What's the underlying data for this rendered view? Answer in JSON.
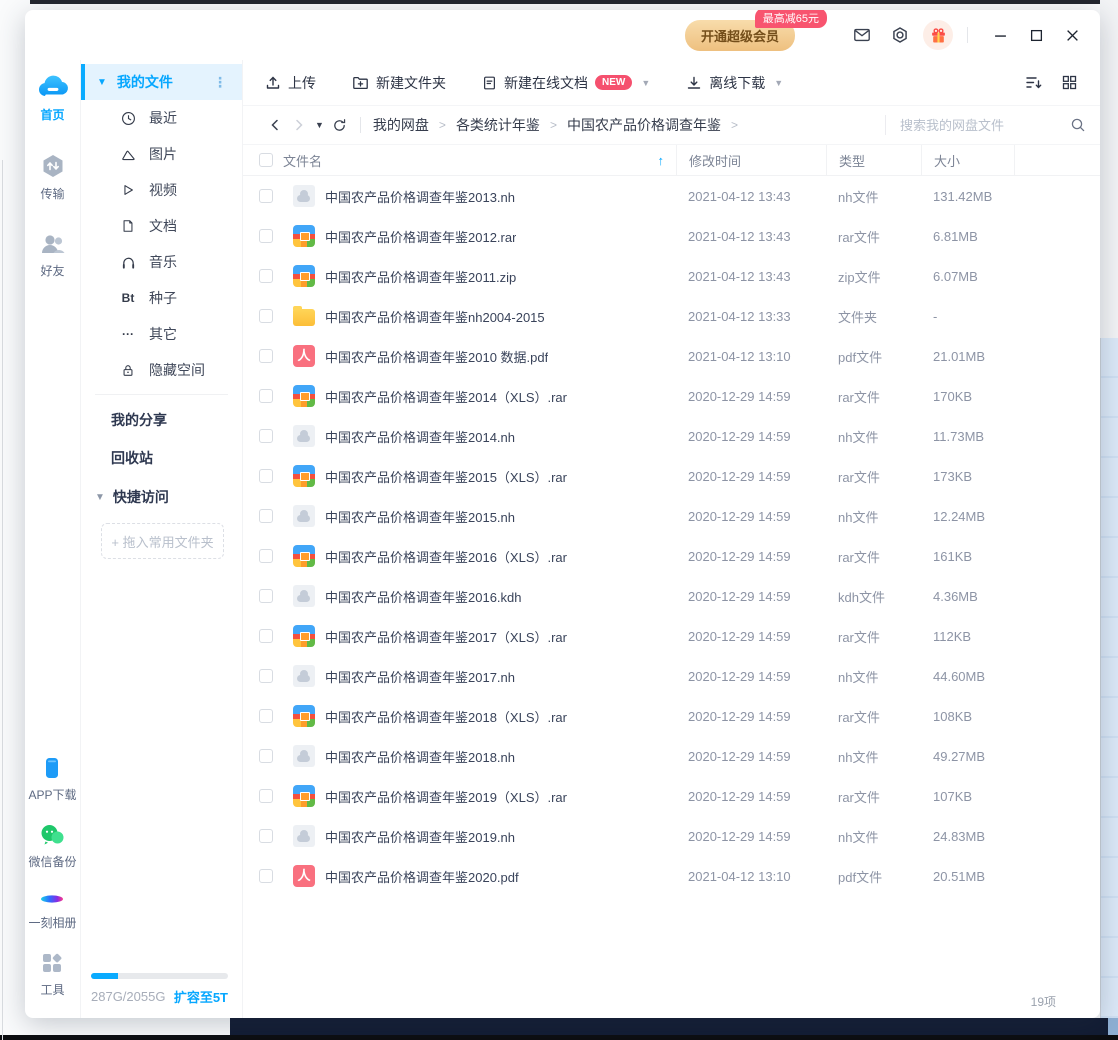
{
  "titlebar": {
    "vip_button": "开通超级会员",
    "vip_badge": "最高减65元"
  },
  "rail": {
    "items": [
      {
        "label": "首页",
        "icon": "cloud-logo"
      },
      {
        "label": "传输",
        "icon": "transfer"
      },
      {
        "label": "好友",
        "icon": "friends"
      }
    ],
    "bottom_items": [
      {
        "label": "APP下载",
        "icon": "phone"
      },
      {
        "label": "微信备份",
        "icon": "wechat"
      },
      {
        "label": "一刻相册",
        "icon": "album"
      },
      {
        "label": "工具",
        "icon": "tools"
      }
    ]
  },
  "sidebar": {
    "my_files": "我的文件",
    "items": [
      {
        "label": "最近",
        "icon": "clock-icon"
      },
      {
        "label": "图片",
        "icon": "image-icon"
      },
      {
        "label": "视频",
        "icon": "video-icon"
      },
      {
        "label": "文档",
        "icon": "doc-icon"
      },
      {
        "label": "音乐",
        "icon": "music-icon"
      },
      {
        "label": "种子",
        "icon": "bt-icon",
        "glyph": "Bt"
      },
      {
        "label": "其它",
        "icon": "more-icon",
        "glyph": "···"
      },
      {
        "label": "隐藏空间",
        "icon": "lock-icon"
      }
    ],
    "my_share": "我的分享",
    "recycle_bin": "回收站",
    "quick_access": "快捷访问",
    "drop_hint": "+ 拖入常用文件夹",
    "storage": {
      "used": "287G/2055G",
      "expand": "扩容至5T",
      "percent": 20
    }
  },
  "toolbar": {
    "upload": "上传",
    "new_folder": "新建文件夹",
    "new_online_doc": "新建在线文档",
    "new_badge": "NEW",
    "offline_download": "离线下载"
  },
  "breadcrumb": {
    "separator": ">",
    "items": [
      "我的网盘",
      "各类统计年鉴",
      "中国农产品价格调查年鉴"
    ]
  },
  "search": {
    "placeholder": "搜索我的网盘文件"
  },
  "table": {
    "headers": [
      "文件名",
      "修改时间",
      "类型",
      "大小"
    ],
    "sort_glyph": "↑",
    "rows": [
      {
        "name": "中国农产品价格调查年鉴2013.nh",
        "icon": "nh",
        "time": "2021-04-12 13:43",
        "type": "nh文件",
        "size": "131.42MB"
      },
      {
        "name": "中国农产品价格调查年鉴2012.rar",
        "icon": "zip",
        "time": "2021-04-12 13:43",
        "type": "rar文件",
        "size": "6.81MB"
      },
      {
        "name": "中国农产品价格调查年鉴2011.zip",
        "icon": "zip",
        "time": "2021-04-12 13:43",
        "type": "zip文件",
        "size": "6.07MB"
      },
      {
        "name": "中国农产品价格调查年鉴nh2004-2015",
        "icon": "folder",
        "time": "2021-04-12 13:33",
        "type": "文件夹",
        "size": "-"
      },
      {
        "name": "中国农产品价格调查年鉴2010 数据.pdf",
        "icon": "pdf",
        "time": "2021-04-12 13:10",
        "type": "pdf文件",
        "size": "21.01MB"
      },
      {
        "name": "中国农产品价格调查年鉴2014（XLS）.rar",
        "icon": "zip",
        "time": "2020-12-29 14:59",
        "type": "rar文件",
        "size": "170KB"
      },
      {
        "name": "中国农产品价格调查年鉴2014.nh",
        "icon": "nh",
        "time": "2020-12-29 14:59",
        "type": "nh文件",
        "size": "11.73MB"
      },
      {
        "name": "中国农产品价格调查年鉴2015（XLS）.rar",
        "icon": "zip",
        "time": "2020-12-29 14:59",
        "type": "rar文件",
        "size": "173KB"
      },
      {
        "name": "中国农产品价格调查年鉴2015.nh",
        "icon": "nh",
        "time": "2020-12-29 14:59",
        "type": "nh文件",
        "size": "12.24MB"
      },
      {
        "name": "中国农产品价格调查年鉴2016（XLS）.rar",
        "icon": "zip",
        "time": "2020-12-29 14:59",
        "type": "rar文件",
        "size": "161KB"
      },
      {
        "name": "中国农产品价格调查年鉴2016.kdh",
        "icon": "nh",
        "time": "2020-12-29 14:59",
        "type": "kdh文件",
        "size": "4.36MB"
      },
      {
        "name": "中国农产品价格调查年鉴2017（XLS）.rar",
        "icon": "zip",
        "time": "2020-12-29 14:59",
        "type": "rar文件",
        "size": "112KB"
      },
      {
        "name": "中国农产品价格调查年鉴2017.nh",
        "icon": "nh",
        "time": "2020-12-29 14:59",
        "type": "nh文件",
        "size": "44.60MB"
      },
      {
        "name": "中国农产品价格调查年鉴2018（XLS）.rar",
        "icon": "zip",
        "time": "2020-12-29 14:59",
        "type": "rar文件",
        "size": "108KB"
      },
      {
        "name": "中国农产品价格调查年鉴2018.nh",
        "icon": "nh",
        "time": "2020-12-29 14:59",
        "type": "nh文件",
        "size": "49.27MB"
      },
      {
        "name": "中国农产品价格调查年鉴2019（XLS）.rar",
        "icon": "zip",
        "time": "2020-12-29 14:59",
        "type": "rar文件",
        "size": "107KB"
      },
      {
        "name": "中国农产品价格调查年鉴2019.nh",
        "icon": "nh",
        "time": "2020-12-29 14:59",
        "type": "nh文件",
        "size": "24.83MB"
      },
      {
        "name": "中国农产品价格调查年鉴2020.pdf",
        "icon": "pdf",
        "time": "2021-04-12 13:10",
        "type": "pdf文件",
        "size": "20.51MB"
      }
    ]
  },
  "footer": {
    "count": "19项"
  }
}
